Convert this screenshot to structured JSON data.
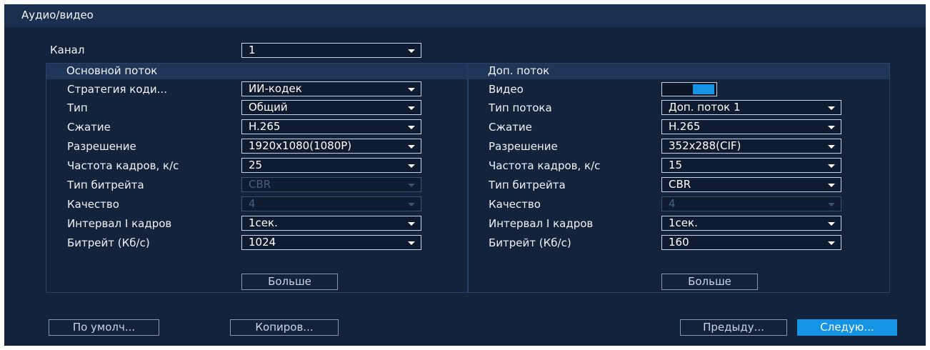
{
  "window": {
    "title": "Аудио/видео"
  },
  "channel": {
    "label": "Канал",
    "value": "1"
  },
  "main_stream": {
    "header": "Основной поток",
    "rows": [
      {
        "label": "Стратегия коди...",
        "value": "ИИ-кодек",
        "enabled": true
      },
      {
        "label": "Тип",
        "value": "Общий",
        "enabled": true
      },
      {
        "label": "Сжатие",
        "value": "H.265",
        "enabled": true
      },
      {
        "label": "Разрешение",
        "value": "1920x1080(1080P)",
        "enabled": true
      },
      {
        "label": "Частота кадров, к/с",
        "value": "25",
        "enabled": true
      },
      {
        "label": "Тип битрейта",
        "value": "CBR",
        "enabled": false
      },
      {
        "label": "Качество",
        "value": "4",
        "enabled": false
      },
      {
        "label": "Интервал I кадров",
        "value": "1сек.",
        "enabled": true
      },
      {
        "label": "Битрейт (Кб/с)",
        "value": "1024",
        "enabled": true
      }
    ],
    "more_button": "Больше"
  },
  "sub_stream": {
    "header": "Доп. поток",
    "video_label": "Видео",
    "video_enabled": true,
    "rows": [
      {
        "label": "Тип потока",
        "value": "Доп. поток 1",
        "enabled": true
      },
      {
        "label": "Сжатие",
        "value": "H.265",
        "enabled": true
      },
      {
        "label": "Разрешение",
        "value": "352x288(CIF)",
        "enabled": true
      },
      {
        "label": "Частота кадров, к/с",
        "value": "15",
        "enabled": true
      },
      {
        "label": "Тип битрейта",
        "value": "CBR",
        "enabled": true
      },
      {
        "label": "Качество",
        "value": "4",
        "enabled": false
      },
      {
        "label": "Интервал I кадров",
        "value": "1сек.",
        "enabled": true
      },
      {
        "label": "Битрейт (Кб/с)",
        "value": "160",
        "enabled": true
      }
    ],
    "more_button": "Больше"
  },
  "footer": {
    "default_button": "По умолч...",
    "copy_button": "Копиров...",
    "prev_button": "Предыду...",
    "next_button": "Следую..."
  },
  "colors": {
    "background": "#14233c",
    "accent": "#1594e6",
    "panel_header": "#203659"
  }
}
